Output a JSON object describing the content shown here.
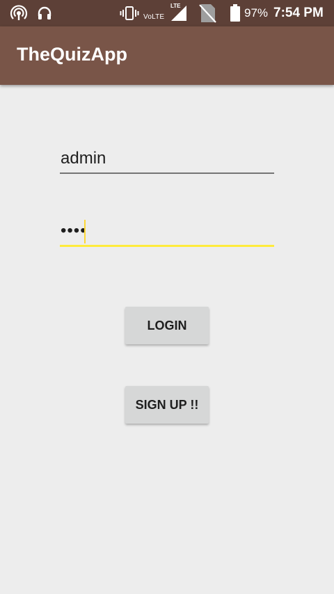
{
  "status_bar": {
    "icons": [
      "hotspot-icon",
      "headset-icon",
      "vibrate-icon",
      "lte-signal-icon",
      "no-sim-icon",
      "battery-icon"
    ],
    "volte": "VoLTE",
    "lte": "LTE",
    "battery_percent": "97%",
    "time": "7:54 PM",
    "background_color": "#5d4037"
  },
  "app_bar": {
    "title": "TheQuizApp",
    "background_color": "#795548"
  },
  "login_form": {
    "username_value": "admin",
    "password_value": "••••",
    "login_label": "LOGIN",
    "signup_label": "SIGN UP !!",
    "focused_underline_color": "#ffeb3b"
  }
}
